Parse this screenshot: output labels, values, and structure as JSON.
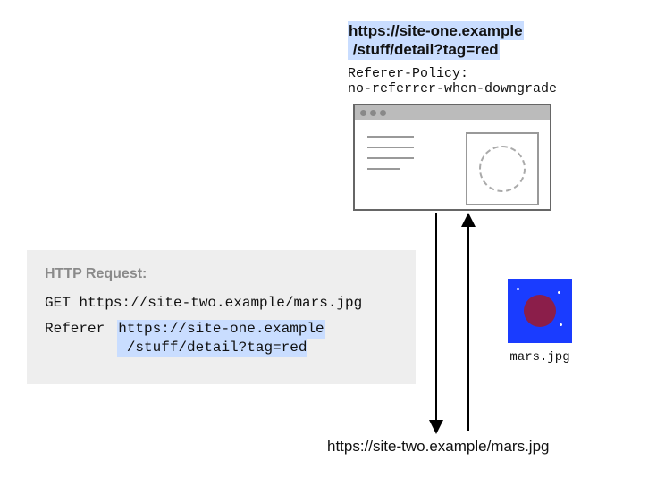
{
  "top_url": {
    "line1": "https://site-one.example",
    "line2": "/stuff/detail?tag=red"
  },
  "policy": {
    "line1": "Referer-Policy:",
    "line2": "no-referrer-when-downgrade"
  },
  "request": {
    "title": "HTTP Request:",
    "method_line": "GET https://site-two.example/mars.jpg",
    "referer_label": "Referer",
    "referer_value": {
      "line1": "https://site-one.example",
      "line2": "/stuff/detail?tag=red"
    }
  },
  "mars_label": "mars.jpg",
  "bottom_url": "https://site-two.example/mars.jpg"
}
